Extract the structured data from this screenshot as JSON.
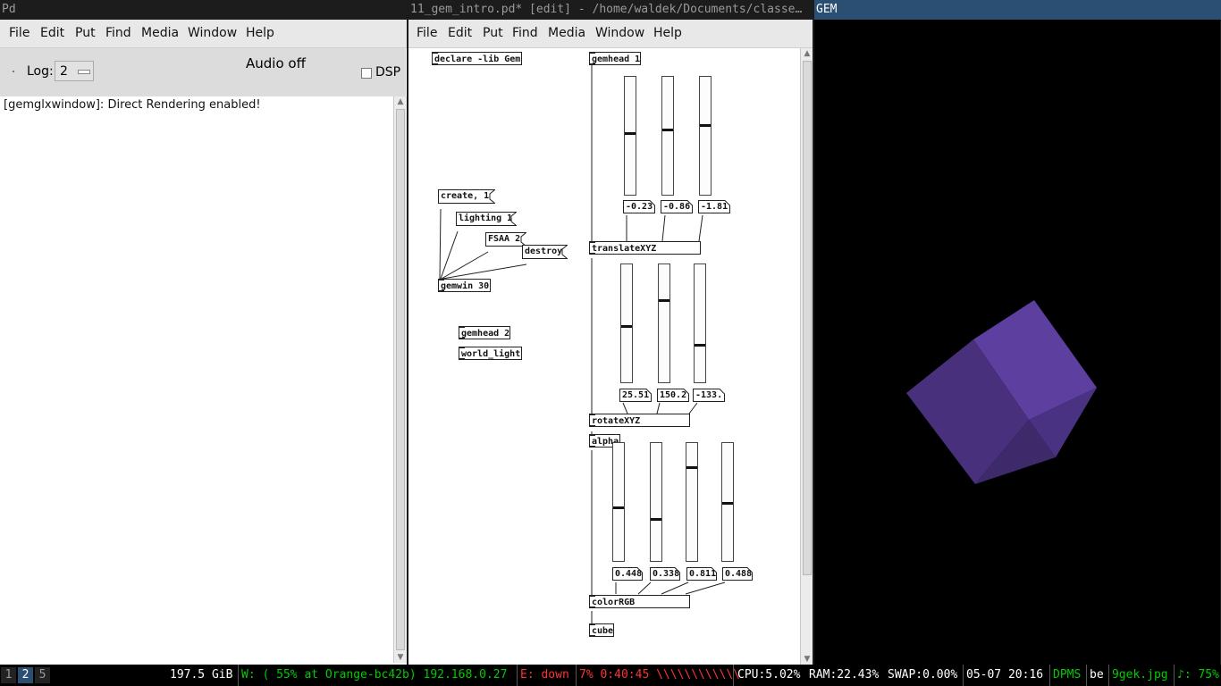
{
  "pd_window": {
    "title": "Pd",
    "menu": [
      "File",
      "Edit",
      "Put",
      "Find",
      "Media",
      "Window",
      "Help"
    ],
    "log_label": "Log:",
    "log_value": "2",
    "audio_status": "Audio off",
    "dsp_label": "DSP",
    "console_lines": [
      "[gemglxwindow]: Direct Rendering enabled!"
    ]
  },
  "patch_window": {
    "title": "11_gem_intro.pd* [edit] - /home/waldek/Documents/classe…",
    "menu": [
      "File",
      "Edit",
      "Put",
      "Find",
      "Media",
      "Window",
      "Help"
    ],
    "objects": {
      "declare": "declare -lib Gem",
      "gemhead1": "gemhead 1",
      "translate": "translateXYZ",
      "rotate": "rotateXYZ",
      "alpha": "alpha",
      "color": "colorRGB",
      "cube": "cube",
      "gemwin": "gemwin 30",
      "gemhead2": "gemhead 2",
      "world_light": "world_light"
    },
    "messages": {
      "create": "create, 1",
      "lighting": "lighting 1",
      "fsaa": "FSAA 2",
      "destroy": "destroy"
    },
    "translate_values": [
      "-0.23",
      "-0.86",
      "-1.81"
    ],
    "rotate_values": [
      "25.51",
      "150.2",
      "-133."
    ],
    "color_values": [
      "0.448",
      "0.338",
      "0.811",
      "0.488"
    ],
    "translate_slider_levels": [
      0.52,
      0.55,
      0.59
    ],
    "rotate_slider_levels": [
      0.47,
      0.7,
      0.31
    ],
    "color_slider_levels": [
      0.45,
      0.35,
      0.8,
      0.49
    ]
  },
  "gem_window": {
    "title": "GEM",
    "cube_colors": [
      "#5c3f9e",
      "#48307d",
      "#3d2a6b",
      "#4a3283"
    ]
  },
  "statusbar": {
    "workspaces": [
      "1",
      "2",
      "5"
    ],
    "active_workspace": "2",
    "disk": "197.5 GiB",
    "wifi": "W: ( 55% at Orange-bc42b) 192.168.0.27",
    "ethernet": "E: down",
    "battery": "7% 0:40:45 \\\\\\\\\\\\\\\\\\\\\\\\",
    "cpu": "CPU:5.02%",
    "ram": "RAM:22.43%",
    "swap": "SWAP:0.00%",
    "datetime": "05-07 20:16",
    "dpms": "DPMS",
    "keyboard": "be",
    "wallpaper": "9gek.jpg",
    "volume": "♪: 75%",
    "colors": {
      "green": "#00cc00",
      "red": "#ff3333",
      "white": "#ffffff"
    }
  }
}
